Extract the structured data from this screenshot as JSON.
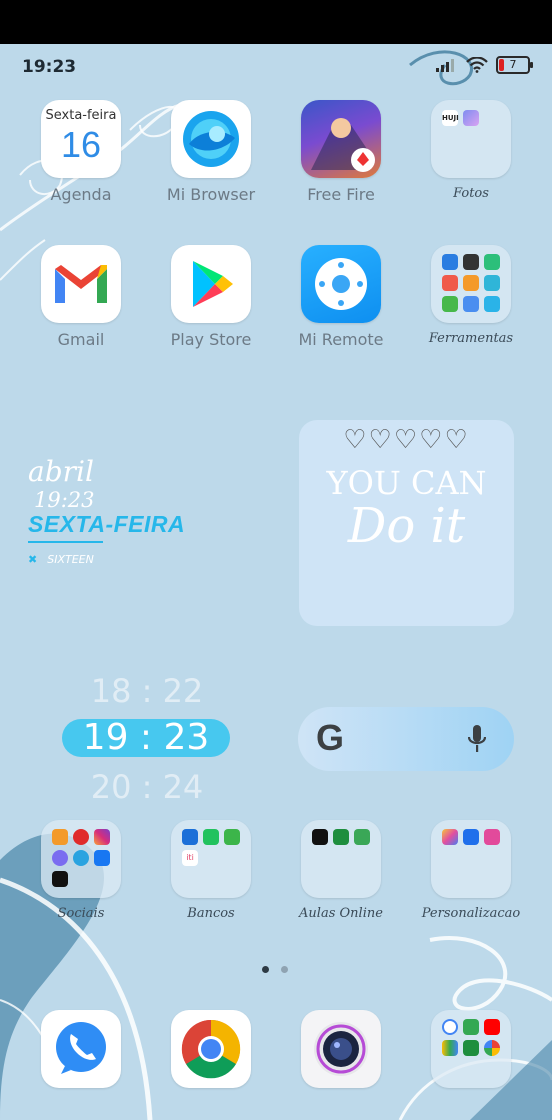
{
  "status": {
    "time": "19:23",
    "battery": "7"
  },
  "row1": [
    {
      "name": "Agenda",
      "calendar_day": "Sexta-feira",
      "calendar_date": "16"
    },
    {
      "name": "Mi Browser"
    },
    {
      "name": "Free Fire"
    },
    {
      "name": "Fotos",
      "minis": [
        "HUJI"
      ]
    }
  ],
  "row2": [
    {
      "name": "Gmail"
    },
    {
      "name": "Play Store"
    },
    {
      "name": "Mi Remote"
    },
    {
      "name": "Ferramentas"
    }
  ],
  "widget": {
    "month": "abril",
    "time": "19:23",
    "weekday": "SEXTA-FEIRA",
    "sub": "SIXTEEN",
    "sub_icon": "✖"
  },
  "card": {
    "hearts": "♡♡♡♡♡",
    "line1": "YOU CAN",
    "line2": "Do it"
  },
  "clock": {
    "prev": "18 : 22",
    "current": "19 : 23",
    "next": "20 : 24"
  },
  "search": {
    "logo": "G"
  },
  "folders": [
    {
      "name": "Sociais"
    },
    {
      "name": "Bancos",
      "mini_text": "iti"
    },
    {
      "name": "Aulas Online"
    },
    {
      "name": "Personalizacao"
    }
  ],
  "dock": [
    "phone-app",
    "chrome-app",
    "camera-app",
    "google-folder"
  ],
  "colors": {
    "background": "#bdd9ea",
    "accent": "#26b7ea",
    "clock_pill": "#47c8ef"
  }
}
